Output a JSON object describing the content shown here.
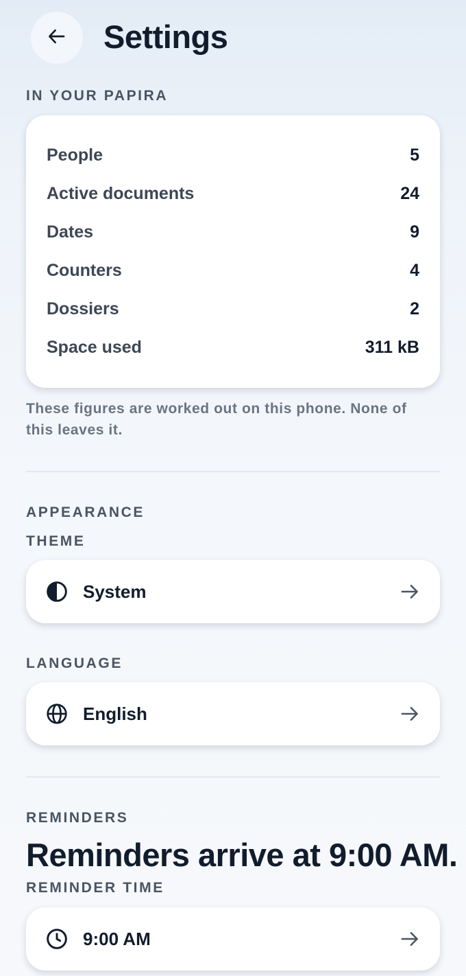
{
  "header": {
    "title": "Settings",
    "back_icon": "arrow-left-icon"
  },
  "stats": {
    "section_label": "IN YOUR PAPIRA",
    "rows": [
      {
        "label": "People",
        "value": "5"
      },
      {
        "label": "Active documents",
        "value": "24"
      },
      {
        "label": "Dates",
        "value": "9"
      },
      {
        "label": "Counters",
        "value": "4"
      },
      {
        "label": "Dossiers",
        "value": "2"
      },
      {
        "label": "Space used",
        "value": "311 kB"
      }
    ],
    "note": "These figures are worked out on this phone. None of this leaves it."
  },
  "appearance": {
    "section_label": "APPEARANCE",
    "theme": {
      "label": "THEME",
      "value": "System",
      "icon": "contrast-icon"
    },
    "language": {
      "label": "LANGUAGE",
      "value": "English",
      "icon": "globe-icon"
    }
  },
  "reminders": {
    "section_label": "REMINDERS",
    "sentence": "Reminders arrive at 9:00 AM.",
    "time": {
      "label": "REMINDER TIME",
      "value": "9:00 AM",
      "icon": "clock-icon"
    }
  },
  "colors": {
    "text_primary": "#111c2c",
    "text_secondary": "#3d4755",
    "card_background": "#ffffff",
    "page_background": "#eef3f9"
  }
}
